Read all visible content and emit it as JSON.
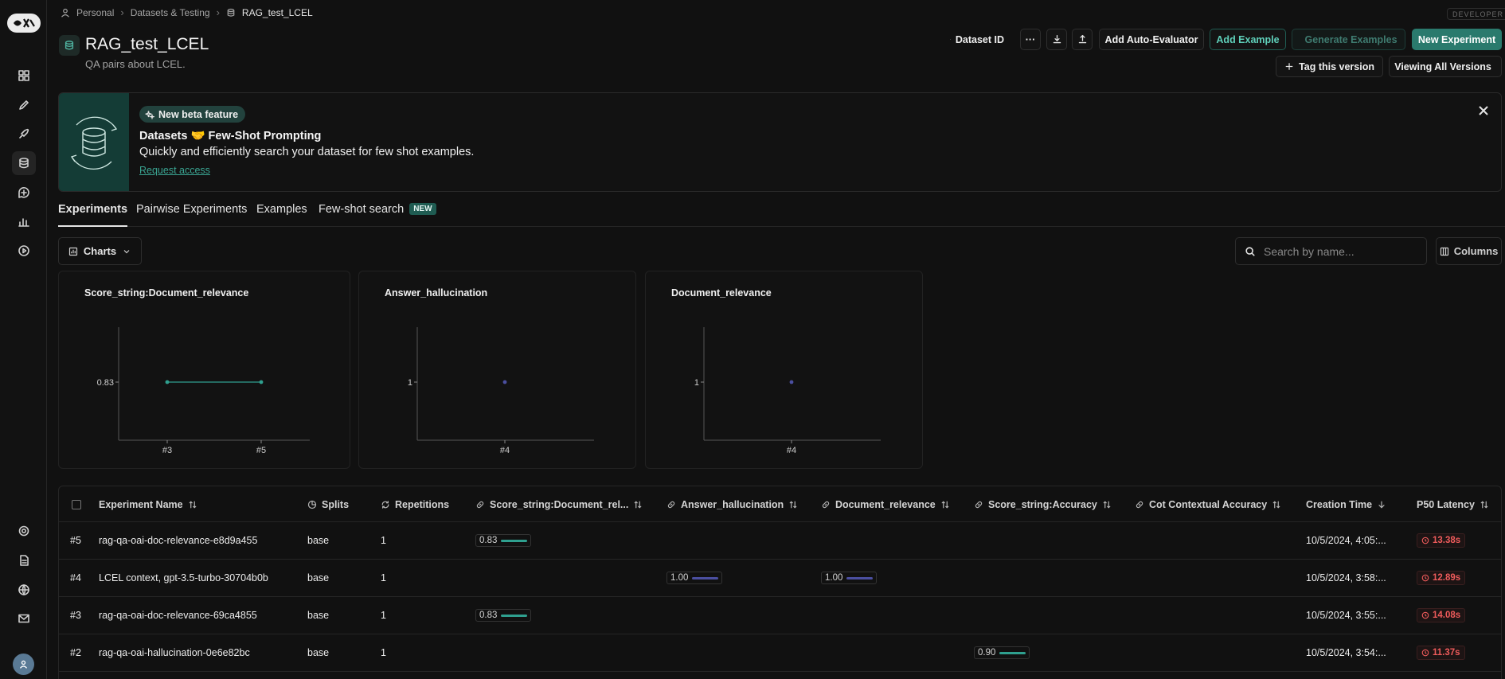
{
  "breadcrumb": {
    "items": [
      "Personal",
      "Datasets & Testing",
      "RAG_test_LCEL"
    ]
  },
  "env_badge": "DEVELOPER",
  "dataset": {
    "title": "RAG_test_LCEL",
    "subtitle": "QA pairs about LCEL."
  },
  "header_actions": {
    "dataset_id": "Dataset ID",
    "more": "···",
    "add_auto_evaluator": "Add Auto-Evaluator",
    "add_example": "Add Example",
    "generate_examples": "Generate Examples",
    "new_experiment": "New Experiment",
    "tag_version": "Tag this version",
    "viewing_versions": "Viewing All Versions"
  },
  "banner": {
    "pill": "New beta feature",
    "heading": "Datasets 🤝 Few-Shot Prompting",
    "description": "Quickly and efficiently search your dataset for few shot examples.",
    "link": "Request access"
  },
  "tabs": [
    {
      "label": "Experiments"
    },
    {
      "label": "Pairwise Experiments"
    },
    {
      "label": "Examples"
    },
    {
      "label": "Few-shot search",
      "badge": "NEW"
    }
  ],
  "controls": {
    "charts": "Charts",
    "search_placeholder": "Search by name...",
    "columns": "Columns"
  },
  "chart_data": [
    {
      "type": "line",
      "title": "Score_string:Document_relevance",
      "x": [
        "#3",
        "#5"
      ],
      "series": [
        {
          "values": [
            0.83,
            0.83
          ]
        }
      ],
      "yticks": [
        "0.83"
      ],
      "color": "#2fa08f"
    },
    {
      "type": "scatter",
      "title": "Answer_hallucination",
      "x": [
        "#4"
      ],
      "series": [
        {
          "values": [
            1
          ]
        }
      ],
      "yticks": [
        "1"
      ],
      "color": "#4b4fa0"
    },
    {
      "type": "scatter",
      "title": "Document_relevance",
      "x": [
        "#4"
      ],
      "series": [
        {
          "values": [
            1
          ]
        }
      ],
      "yticks": [
        "1"
      ],
      "color": "#4b4fa0"
    }
  ],
  "table": {
    "columns": [
      "Experiment Name",
      "Splits",
      "Repetitions",
      "Score_string:Document_rel...",
      "Answer_hallucination",
      "Document_relevance",
      "Score_string:Accuracy",
      "Cot Contextual Accuracy",
      "Creation Time",
      "P50 Latency"
    ],
    "rows": [
      {
        "id": "#5",
        "name": "rag-qa-oai-doc-relevance-e8d9a455",
        "split": "base",
        "reps": "1",
        "doc_rel_score": "0.83",
        "answer_hall": "",
        "doc_rel": "",
        "accuracy": "",
        "cot": "",
        "created": "10/5/2024, 4:05:...",
        "latency": "13.38s"
      },
      {
        "id": "#4",
        "name": "LCEL context, gpt-3.5-turbo-30704b0b",
        "split": "base",
        "reps": "1",
        "doc_rel_score": "",
        "answer_hall": "1.00",
        "doc_rel": "1.00",
        "accuracy": "",
        "cot": "",
        "created": "10/5/2024, 3:58:...",
        "latency": "12.89s"
      },
      {
        "id": "#3",
        "name": "rag-qa-oai-doc-relevance-69ca4855",
        "split": "base",
        "reps": "1",
        "doc_rel_score": "0.83",
        "answer_hall": "",
        "doc_rel": "",
        "accuracy": "",
        "cot": "",
        "created": "10/5/2024, 3:55:...",
        "latency": "14.08s"
      },
      {
        "id": "#2",
        "name": "rag-qa-oai-hallucination-0e6e82bc",
        "split": "base",
        "reps": "1",
        "doc_rel_score": "",
        "answer_hall": "",
        "doc_rel": "",
        "accuracy": "0.90",
        "cot": "",
        "created": "10/5/2024, 3:54:...",
        "latency": "11.37s"
      }
    ]
  },
  "colors": {
    "accent": "#2a7a6d",
    "teal_bar": "#2fa08f",
    "purple_bar": "#4b4fa0",
    "latency_red": "#ef5b5b"
  }
}
